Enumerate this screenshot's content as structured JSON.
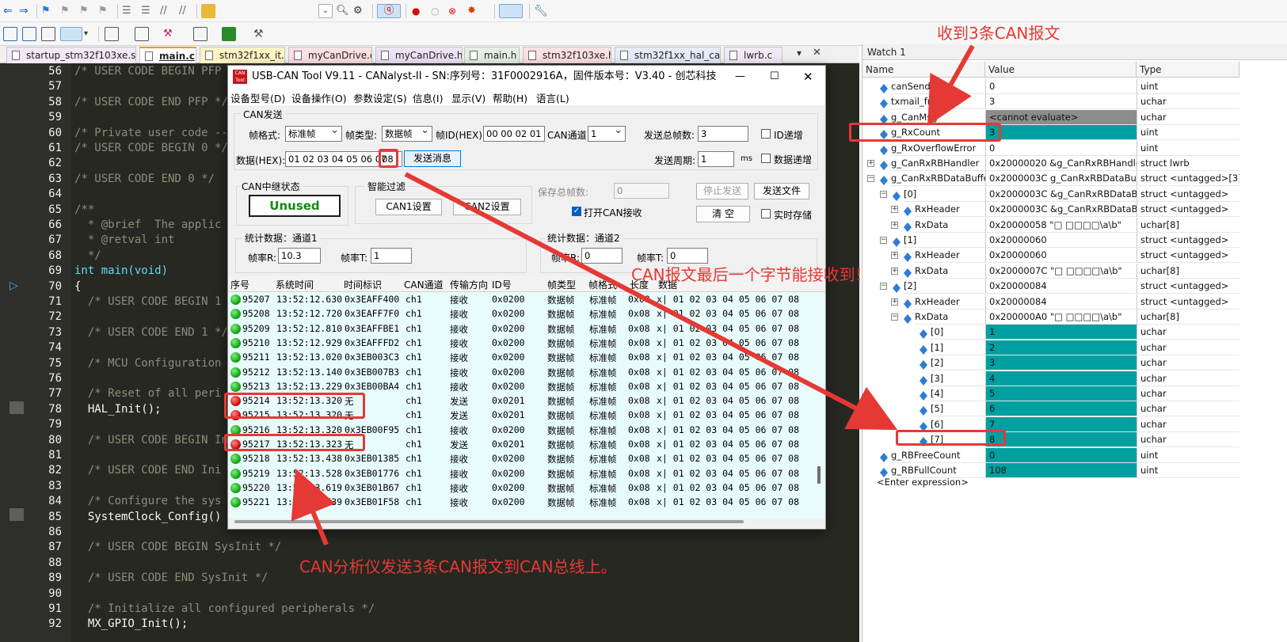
{
  "editor": {
    "tabs": [
      "startup_stm32f103xe.s",
      "main.c",
      "stm32f1xx_it.c",
      "myCanDrive.c",
      "myCanDrive.h",
      "main.h",
      "stm32f103xe.h",
      "stm32f1xx_hal_can.h",
      "lwrb.c"
    ],
    "active_tab": "main.c",
    "lines": [
      {
        "n": "56",
        "text": "/* USER CODE BEGIN PFP */"
      },
      {
        "n": "57",
        "text": ""
      },
      {
        "n": "58",
        "text": "/* USER CODE END PFP */"
      },
      {
        "n": "59",
        "text": ""
      },
      {
        "n": "60",
        "text": "/* Private user code ---"
      },
      {
        "n": "61",
        "text": "/* USER CODE BEGIN 0 */"
      },
      {
        "n": "62",
        "text": ""
      },
      {
        "n": "63",
        "text": "/* USER CODE END 0 */"
      },
      {
        "n": "64",
        "text": ""
      },
      {
        "n": "65",
        "text": "/**"
      },
      {
        "n": "66",
        "text": "  * @brief  The applic"
      },
      {
        "n": "67",
        "text": "  * @retval int"
      },
      {
        "n": "68",
        "text": "  */"
      },
      {
        "n": "69",
        "text": "int main(void)"
      },
      {
        "n": "70",
        "text": "{"
      },
      {
        "n": "71",
        "text": "  /* USER CODE BEGIN 1"
      },
      {
        "n": "72",
        "text": ""
      },
      {
        "n": "73",
        "text": "  /* USER CODE END 1 */"
      },
      {
        "n": "74",
        "text": ""
      },
      {
        "n": "75",
        "text": "  /* MCU Configuration"
      },
      {
        "n": "76",
        "text": ""
      },
      {
        "n": "77",
        "text": "  /* Reset of all peri"
      },
      {
        "n": "78",
        "text": "  HAL_Init();"
      },
      {
        "n": "79",
        "text": ""
      },
      {
        "n": "80",
        "text": "  /* USER CODE BEGIN In"
      },
      {
        "n": "81",
        "text": ""
      },
      {
        "n": "82",
        "text": "  /* USER CODE END Ini"
      },
      {
        "n": "83",
        "text": ""
      },
      {
        "n": "84",
        "text": "  /* Configure the sys"
      },
      {
        "n": "85",
        "text": "  SystemClock_Config()"
      },
      {
        "n": "86",
        "text": ""
      },
      {
        "n": "87",
        "text": "  /* USER CODE BEGIN SysInit */"
      },
      {
        "n": "88",
        "text": ""
      },
      {
        "n": "89",
        "text": "  /* USER CODE END SysInit */"
      },
      {
        "n": "90",
        "text": ""
      },
      {
        "n": "91",
        "text": "  /* Initialize all configured peripherals */"
      },
      {
        "n": "92",
        "text": "  MX_GPIO_Init();"
      }
    ]
  },
  "cantool": {
    "title": "USB-CAN Tool V9.11 - CANalyst-II - SN:序列号：31F0002916A，固件版本号：V3.40 - 创芯科技",
    "logo": "CAN Tool",
    "menu": [
      "设备型号(D)",
      "设备操作(O)",
      "参数设定(S)",
      "信息(I)",
      "显示(V)",
      "帮助(H)",
      "语言(L)"
    ],
    "send_group": "CAN发送",
    "frame_format_label": "帧格式:",
    "frame_format": "标准帧",
    "frame_type_label": "帧类型:",
    "frame_type": "数据帧",
    "frame_id_label": "帧ID(HEX):",
    "frame_id": "00 00 02 01",
    "channel_label": "CAN通道:",
    "channel": "1",
    "total_frames_label": "发送总帧数:",
    "total_frames": "3",
    "id_increment": "ID递增",
    "data_label": "数据(HEX):",
    "data": "01 02 03 04 05 06 07",
    "data_last": "08",
    "send_button": "发送消息",
    "period_label": "发送周期:",
    "period": "1",
    "period_unit": "ms",
    "data_increment": "数据递增",
    "relay_group": "CAN中继状态",
    "relay_status": "Unused",
    "filter_group": "智能过滤",
    "can1_setting": "CAN1设置",
    "can2_setting": "CAN2设置",
    "saved_frames_label": "保存总帧数:",
    "saved_frames": "0",
    "stop_send": "停止发送",
    "send_file": "发送文件",
    "open_receive": "打开CAN接收",
    "clear": "清 空",
    "realtime_save": "实时存储",
    "stats1_title": "统计数据：通道1",
    "stats2_title": "统计数据：通道2",
    "rate_r_label": "帧率R:",
    "rate_t_label": "帧率T:",
    "ch1_rate_r": "10.3",
    "ch1_rate_t": "1",
    "ch2_rate_r": "0",
    "ch2_rate_t": "0",
    "columns": [
      "序号",
      "系统时间",
      "时间标识",
      "CAN通道",
      "传输方向",
      "ID号",
      "帧类型",
      "帧格式",
      "长度",
      "数据"
    ],
    "rows": [
      {
        "status": "green",
        "seq": "95207",
        "time": "13:52:12.630",
        "stamp": "0x3EAFF400",
        "ch": "ch1",
        "dir": "接收",
        "id": "0x0200",
        "type": "数据帧",
        "fmt": "标准帧",
        "len": "0x08",
        "data": "x| 01 02 03 04 05 06 07 08"
      },
      {
        "status": "green",
        "seq": "95208",
        "time": "13:52:12.720",
        "stamp": "0x3EAFF7F0",
        "ch": "ch1",
        "dir": "接收",
        "id": "0x0200",
        "type": "数据帧",
        "fmt": "标准帧",
        "len": "0x08",
        "data": "x| 01 02 03 04 05 06 07 08"
      },
      {
        "status": "green",
        "seq": "95209",
        "time": "13:52:12.810",
        "stamp": "0x3EAFFBE1",
        "ch": "ch1",
        "dir": "接收",
        "id": "0x0200",
        "type": "数据帧",
        "fmt": "标准帧",
        "len": "0x08",
        "data": "x| 01 02 03 04 05 06 07 08"
      },
      {
        "status": "green",
        "seq": "95210",
        "time": "13:52:12.929",
        "stamp": "0x3EAFFFD2",
        "ch": "ch1",
        "dir": "接收",
        "id": "0x0200",
        "type": "数据帧",
        "fmt": "标准帧",
        "len": "0x08",
        "data": "x| 01 02 03 04 05 06 07 08"
      },
      {
        "status": "green",
        "seq": "95211",
        "time": "13:52:13.020",
        "stamp": "0x3EB003C3",
        "ch": "ch1",
        "dir": "接收",
        "id": "0x0200",
        "type": "数据帧",
        "fmt": "标准帧",
        "len": "0x08",
        "data": "x| 01 02 03 04 05 06 07 08"
      },
      {
        "status": "green",
        "seq": "95212",
        "time": "13:52:13.140",
        "stamp": "0x3EB007B3",
        "ch": "ch1",
        "dir": "接收",
        "id": "0x0200",
        "type": "数据帧",
        "fmt": "标准帧",
        "len": "0x08",
        "data": "x| 01 02 03 04 05 06 07 08"
      },
      {
        "status": "green",
        "seq": "95213",
        "time": "13:52:13.229",
        "stamp": "0x3EB00BA4",
        "ch": "ch1",
        "dir": "接收",
        "id": "0x0200",
        "type": "数据帧",
        "fmt": "标准帧",
        "len": "0x08",
        "data": "x| 01 02 03 04 05 06 07 08"
      },
      {
        "status": "red",
        "seq": "95214",
        "time": "13:52:13.320",
        "stamp": "无",
        "ch": "ch1",
        "dir": "发送",
        "id": "0x0201",
        "type": "数据帧",
        "fmt": "标准帧",
        "len": "0x08",
        "data": "x| 01 02 03 04 05 06 07 08"
      },
      {
        "status": "red",
        "seq": "95215",
        "time": "13:52:13.320",
        "stamp": "无",
        "ch": "ch1",
        "dir": "发送",
        "id": "0x0201",
        "type": "数据帧",
        "fmt": "标准帧",
        "len": "0x08",
        "data": "x| 01 02 03 04 05 06 07 08"
      },
      {
        "status": "green",
        "seq": "95216",
        "time": "13:52:13.320",
        "stamp": "0x3EB00F95",
        "ch": "ch1",
        "dir": "接收",
        "id": "0x0200",
        "type": "数据帧",
        "fmt": "标准帧",
        "len": "0x08",
        "data": "x| 01 02 03 04 05 06 07 08"
      },
      {
        "status": "red",
        "seq": "95217",
        "time": "13:52:13.323",
        "stamp": "无",
        "ch": "ch1",
        "dir": "发送",
        "id": "0x0201",
        "type": "数据帧",
        "fmt": "标准帧",
        "len": "0x08",
        "data": "x| 01 02 03 04 05 06 07 08"
      },
      {
        "status": "green",
        "seq": "95218",
        "time": "13:52:13.438",
        "stamp": "0x3EB01385",
        "ch": "ch1",
        "dir": "接收",
        "id": "0x0200",
        "type": "数据帧",
        "fmt": "标准帧",
        "len": "0x08",
        "data": "x| 01 02 03 04 05 06 07 08"
      },
      {
        "status": "green",
        "seq": "95219",
        "time": "13:52:13.528",
        "stamp": "0x3EB01776",
        "ch": "ch1",
        "dir": "接收",
        "id": "0x0200",
        "type": "数据帧",
        "fmt": "标准帧",
        "len": "0x08",
        "data": "x| 01 02 03 04 05 06 07 08"
      },
      {
        "status": "green",
        "seq": "95220",
        "time": "13:52:13.619",
        "stamp": "0x3EB01B67",
        "ch": "ch1",
        "dir": "接收",
        "id": "0x0200",
        "type": "数据帧",
        "fmt": "标准帧",
        "len": "0x08",
        "data": "x| 01 02 03 04 05 06 07 08"
      },
      {
        "status": "green",
        "seq": "95221",
        "time": "13:52:13.739",
        "stamp": "0x3EB01F58",
        "ch": "ch1",
        "dir": "接收",
        "id": "0x0200",
        "type": "数据帧",
        "fmt": "标准帧",
        "len": "0x08",
        "data": "x| 01 02 03 04 05 06 07 08"
      }
    ]
  },
  "watch": {
    "title": "Watch 1",
    "columns": [
      "Name",
      "Value",
      "Type"
    ],
    "rows": [
      {
        "name": "canSendError",
        "value": "0",
        "type": "uint",
        "level": 0,
        "tree": "",
        "hl": ""
      },
      {
        "name": "txmail_free",
        "value": "3",
        "type": "uchar",
        "level": 0,
        "tree": "",
        "hl": ""
      },
      {
        "name": "g_CanMsg",
        "value": "<cannot evaluate>",
        "type": "uchar",
        "level": 0,
        "tree": "",
        "hl": "gray"
      },
      {
        "name": "g_RxCount",
        "value": "3",
        "type": "uint",
        "level": 0,
        "tree": "",
        "hl": "teal"
      },
      {
        "name": "g_RxOverflowError",
        "value": "0",
        "type": "uint",
        "level": 0,
        "tree": "",
        "hl": ""
      },
      {
        "name": "g_CanRxRBHandler",
        "value": "0x20000020 &g_CanRxRBHandler",
        "type": "struct lwrb",
        "level": 0,
        "tree": "+",
        "hl": ""
      },
      {
        "name": "g_CanRxRBDataBuffer",
        "value": "0x2000003C g_CanRxRBDataBuffer",
        "type": "struct <untagged>[3]",
        "level": 0,
        "tree": "-",
        "hl": ""
      },
      {
        "name": "[0]",
        "value": "0x2000003C &g_CanRxRBDataBuffer",
        "type": "struct <untagged>",
        "level": 1,
        "tree": "-",
        "hl": ""
      },
      {
        "name": "RxHeader",
        "value": "0x2000003C &g_CanRxRBDataBuffer",
        "type": "struct <untagged>",
        "level": 2,
        "tree": "+",
        "hl": ""
      },
      {
        "name": "RxData",
        "value": "0x20000058 \"□ □□□□\\a\\b\"",
        "type": "uchar[8]",
        "level": 2,
        "tree": "+",
        "hl": ""
      },
      {
        "name": "[1]",
        "value": "0x20000060",
        "type": "struct <untagged>",
        "level": 1,
        "tree": "-",
        "hl": ""
      },
      {
        "name": "RxHeader",
        "value": "0x20000060",
        "type": "struct <untagged>",
        "level": 2,
        "tree": "+",
        "hl": ""
      },
      {
        "name": "RxData",
        "value": "0x2000007C \"□ □□□□\\a\\b\"",
        "type": "uchar[8]",
        "level": 2,
        "tree": "+",
        "hl": ""
      },
      {
        "name": "[2]",
        "value": "0x20000084",
        "type": "struct <untagged>",
        "level": 1,
        "tree": "-",
        "hl": ""
      },
      {
        "name": "RxHeader",
        "value": "0x20000084",
        "type": "struct <untagged>",
        "level": 2,
        "tree": "+",
        "hl": ""
      },
      {
        "name": "RxData",
        "value": "0x200000A0 \"□ □□□□\\a\\b\"",
        "type": "uchar[8]",
        "level": 2,
        "tree": "-",
        "hl": ""
      },
      {
        "name": "[0]",
        "value": "1",
        "type": "uchar",
        "level": 3,
        "tree": "",
        "hl": "teal"
      },
      {
        "name": "[1]",
        "value": "2",
        "type": "uchar",
        "level": 3,
        "tree": "",
        "hl": "teal"
      },
      {
        "name": "[2]",
        "value": "3",
        "type": "uchar",
        "level": 3,
        "tree": "",
        "hl": "teal"
      },
      {
        "name": "[3]",
        "value": "4",
        "type": "uchar",
        "level": 3,
        "tree": "",
        "hl": "teal"
      },
      {
        "name": "[4]",
        "value": "5",
        "type": "uchar",
        "level": 3,
        "tree": "",
        "hl": "teal"
      },
      {
        "name": "[5]",
        "value": "6",
        "type": "uchar",
        "level": 3,
        "tree": "",
        "hl": "teal"
      },
      {
        "name": "[6]",
        "value": "7",
        "type": "uchar",
        "level": 3,
        "tree": "",
        "hl": "teal"
      },
      {
        "name": "[7]",
        "value": "8",
        "type": "uchar",
        "level": 3,
        "tree": "",
        "hl": "teal"
      },
      {
        "name": "g_RBFreeCount",
        "value": "0",
        "type": "uint",
        "level": 0,
        "tree": "",
        "hl": "teal"
      },
      {
        "name": "g_RBFullCount",
        "value": "108",
        "type": "uint",
        "level": 0,
        "tree": "",
        "hl": "teal"
      }
    ],
    "enter_expression": "<Enter expression>"
  },
  "annotations": {
    "top": "收到3条CAN报文",
    "middle": "CAN报文最后一个字节能接收到！",
    "bottom": "CAN分析仪发送3条CAN报文到CAN总线上。"
  },
  "colors": {
    "annotation_red": "#e53935",
    "watch_highlight": "#00a0a0",
    "editor_bg": "#272822",
    "relay_status": "#138a13"
  }
}
